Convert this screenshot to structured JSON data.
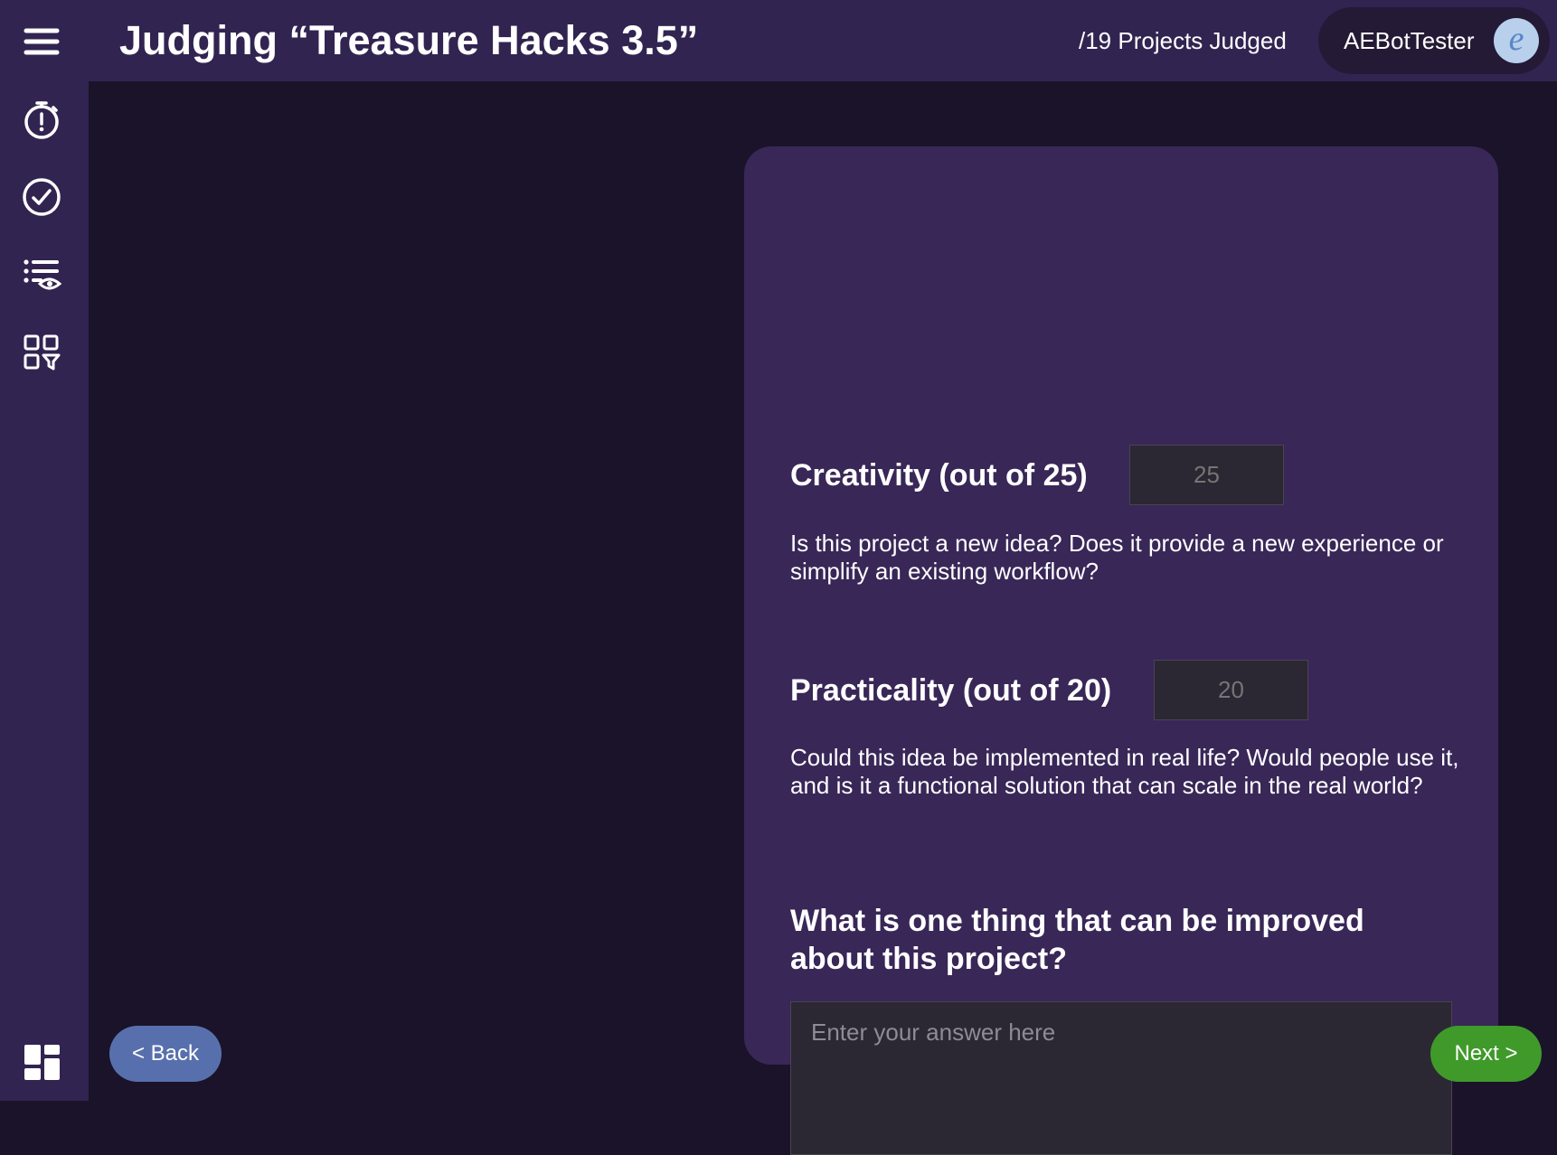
{
  "header": {
    "title": "Judging “Treasure Hacks 3.5”",
    "progress": "/19 Projects Judged",
    "user_name": "AEBotTester",
    "avatar_letter": "e"
  },
  "sidebar": {
    "icons": [
      "menu-icon",
      "stopwatch-alert-icon",
      "check-circle-icon",
      "list-eye-icon",
      "grid-filter-icon",
      "dashboard-icon"
    ]
  },
  "form": {
    "criteria": [
      {
        "label": "Creativity (out of 25)",
        "placeholder": "25",
        "description": "Is this project a new idea? Does it provide a new experience or simplify an existing workflow?"
      },
      {
        "label": "Practicality (out of 20)",
        "placeholder": "20",
        "description": "Could this idea be implemented in real life? Would people use it, and is it a functional solution that can scale in the real world?"
      }
    ],
    "question": "What is one thing that can be improved about this project?",
    "answer_placeholder": "Enter your answer here"
  },
  "nav": {
    "back_label": "< Back",
    "next_label": "Next >"
  },
  "colors": {
    "background": "#1b1329",
    "bar": "#322451",
    "card": "#382757",
    "back_button": "#5770ad",
    "next_button": "#3f9a2a"
  }
}
